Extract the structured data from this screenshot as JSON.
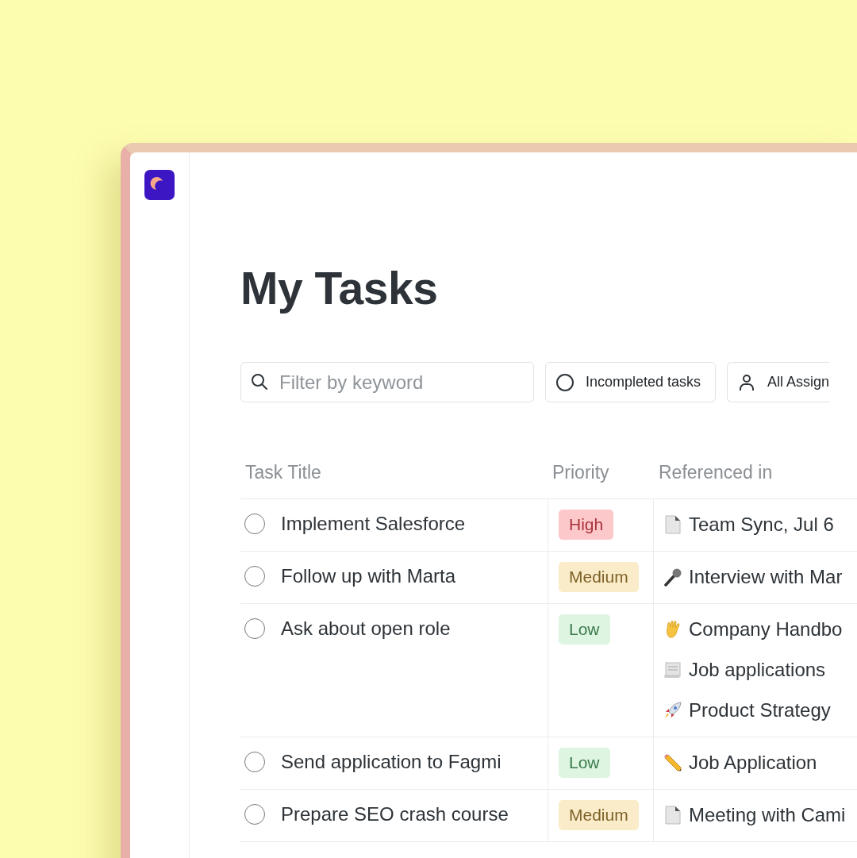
{
  "title": "My Tasks",
  "filters": {
    "search": {
      "placeholder": "Filter by keyword"
    },
    "status": "Incompleted tasks",
    "assignee": "All Assign"
  },
  "table": {
    "columns": [
      "Task Title",
      "Priority",
      "Referenced in"
    ],
    "rows": [
      {
        "title": "Implement Salesforce",
        "checked": false,
        "priority": {
          "label": "High",
          "color": "#fdc8ca"
        },
        "references": [
          {
            "kind": "document",
            "label": "Team Sync, Jul 6"
          }
        ]
      },
      {
        "title": "Follow up with Marta",
        "checked": false,
        "priority": {
          "label": "Medium",
          "color": "#fbecc9"
        },
        "references": [
          {
            "kind": "microphone",
            "label": "Interview with Mar"
          }
        ]
      },
      {
        "title": "Ask about open role",
        "checked": false,
        "priority": {
          "label": "Low",
          "color": "#ddf5e1"
        },
        "references": [
          {
            "kind": "hand",
            "label": "Company Handbo"
          },
          {
            "kind": "scroll",
            "label": "Job applications"
          },
          {
            "kind": "rocket",
            "label": "Product Strategy"
          }
        ]
      },
      {
        "title": "Send application to Fagmi",
        "checked": false,
        "priority": {
          "label": "Low",
          "color": "#ddf5e1"
        },
        "references": [
          {
            "kind": "pencil",
            "label": "Job Application"
          }
        ]
      },
      {
        "title": "Prepare SEO crash course",
        "checked": false,
        "priority": {
          "label": "Medium",
          "color": "#fbecc9"
        },
        "references": [
          {
            "kind": "document",
            "label": "Meeting with Cami"
          }
        ]
      }
    ]
  }
}
